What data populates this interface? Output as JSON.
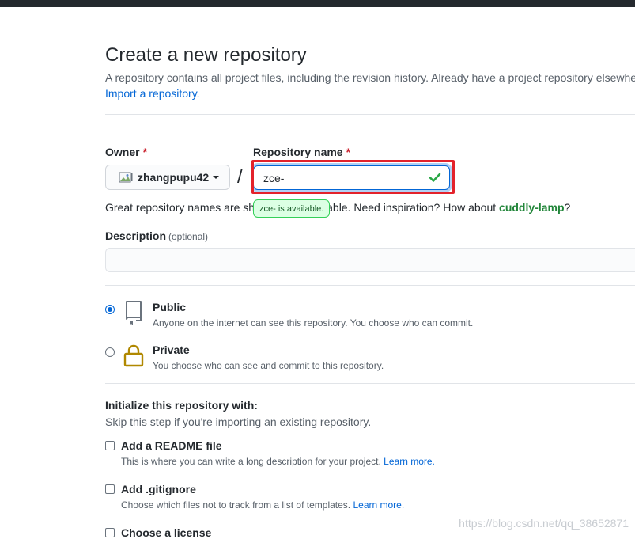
{
  "header": {
    "title": "Create a new repository",
    "subtitle": "A repository contains all project files, including the revision history. Already have a project repository elsewhere?",
    "import_link": "Import a repository."
  },
  "owner": {
    "label": "Owner",
    "required_mark": "*",
    "name": "zhangpupu42",
    "avatar_icon": "avatar-broken-image-icon"
  },
  "repo": {
    "separator": "/",
    "label": "Repository name",
    "required_mark": "*",
    "value": "zce-",
    "status_icon": "check-icon",
    "tooltip": "zce- is available.",
    "hint_prefix": "Great repository names are short and memorable. Need inspiration? How about ",
    "suggestion": "cuddly-lamp",
    "hint_suffix": "?"
  },
  "description": {
    "label": "Description",
    "optional": "(optional)",
    "value": ""
  },
  "visibility": {
    "options": [
      {
        "title": "Public",
        "desc": "Anyone on the internet can see this repository. You choose who can commit.",
        "checked": true,
        "icon": "repo-icon"
      },
      {
        "title": "Private",
        "desc": "You choose who can see and commit to this repository.",
        "checked": false,
        "icon": "lock-icon"
      }
    ]
  },
  "init": {
    "heading": "Initialize this repository with:",
    "subheading": "Skip this step if you're importing an existing repository.",
    "items": [
      {
        "label": "Add a README file",
        "desc": "This is where you can write a long description for your project.",
        "link": "Learn more."
      },
      {
        "label": "Add .gitignore",
        "desc": "Choose which files not to track from a list of templates.",
        "link": "Learn more."
      },
      {
        "label": "Choose a license",
        "desc": "",
        "link": ""
      }
    ]
  },
  "watermark": "https://blog.csdn.net/qq_38652871",
  "colors": {
    "accent": "#0366d6",
    "success": "#28a745",
    "required": "#cb2431",
    "highlight": "#e3222b",
    "lock": "#b08800"
  }
}
